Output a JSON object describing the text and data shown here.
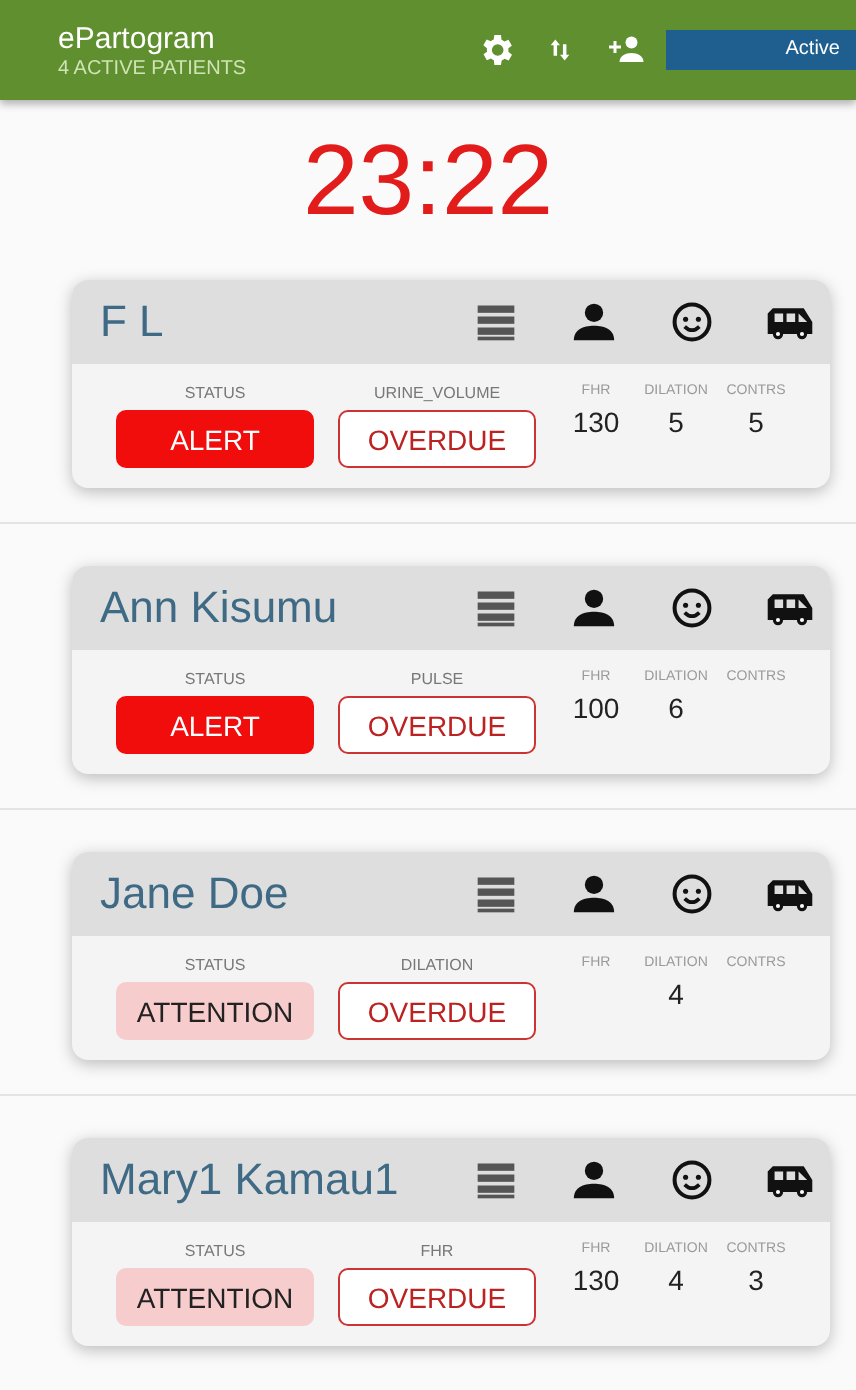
{
  "app_bar": {
    "title": "ePartogram",
    "subtitle": "4 ACTIVE PATIENTS",
    "filter": "Active"
  },
  "timer": "23:22",
  "patients": [
    {
      "name": "F L",
      "status": {
        "label": "STATUS",
        "value": "ALERT",
        "kind": "alert"
      },
      "due": {
        "label": "URINE_VOLUME",
        "value": "OVERDUE"
      },
      "vitals": [
        {
          "label": "FHR",
          "value": "130"
        },
        {
          "label": "DILATION",
          "value": "5"
        },
        {
          "label": "CONTRS",
          "value": "5"
        }
      ]
    },
    {
      "name": "Ann  Kisumu",
      "status": {
        "label": "STATUS",
        "value": "ALERT",
        "kind": "alert"
      },
      "due": {
        "label": "PULSE",
        "value": "OVERDUE"
      },
      "vitals": [
        {
          "label": "FHR",
          "value": "100"
        },
        {
          "label": "DILATION",
          "value": "6"
        },
        {
          "label": "CONTRS"
        }
      ]
    },
    {
      "name": "Jane  Doe",
      "status": {
        "label": "STATUS",
        "value": "ATTENTION",
        "kind": "attention"
      },
      "due": {
        "label": "DILATION",
        "value": "OVERDUE"
      },
      "vitals": [
        {
          "label": "FHR"
        },
        {
          "label": "DILATION",
          "value": "4"
        },
        {
          "label": "CONTRS"
        }
      ]
    },
    {
      "name": "Mary1  Kamau1",
      "status": {
        "label": "STATUS",
        "value": "ATTENTION",
        "kind": "attention"
      },
      "due": {
        "label": "FHR",
        "value": "OVERDUE"
      },
      "vitals": [
        {
          "label": "FHR",
          "value": "130"
        },
        {
          "label": "DILATION",
          "value": "4"
        },
        {
          "label": "CONTRS",
          "value": "3"
        }
      ]
    }
  ]
}
